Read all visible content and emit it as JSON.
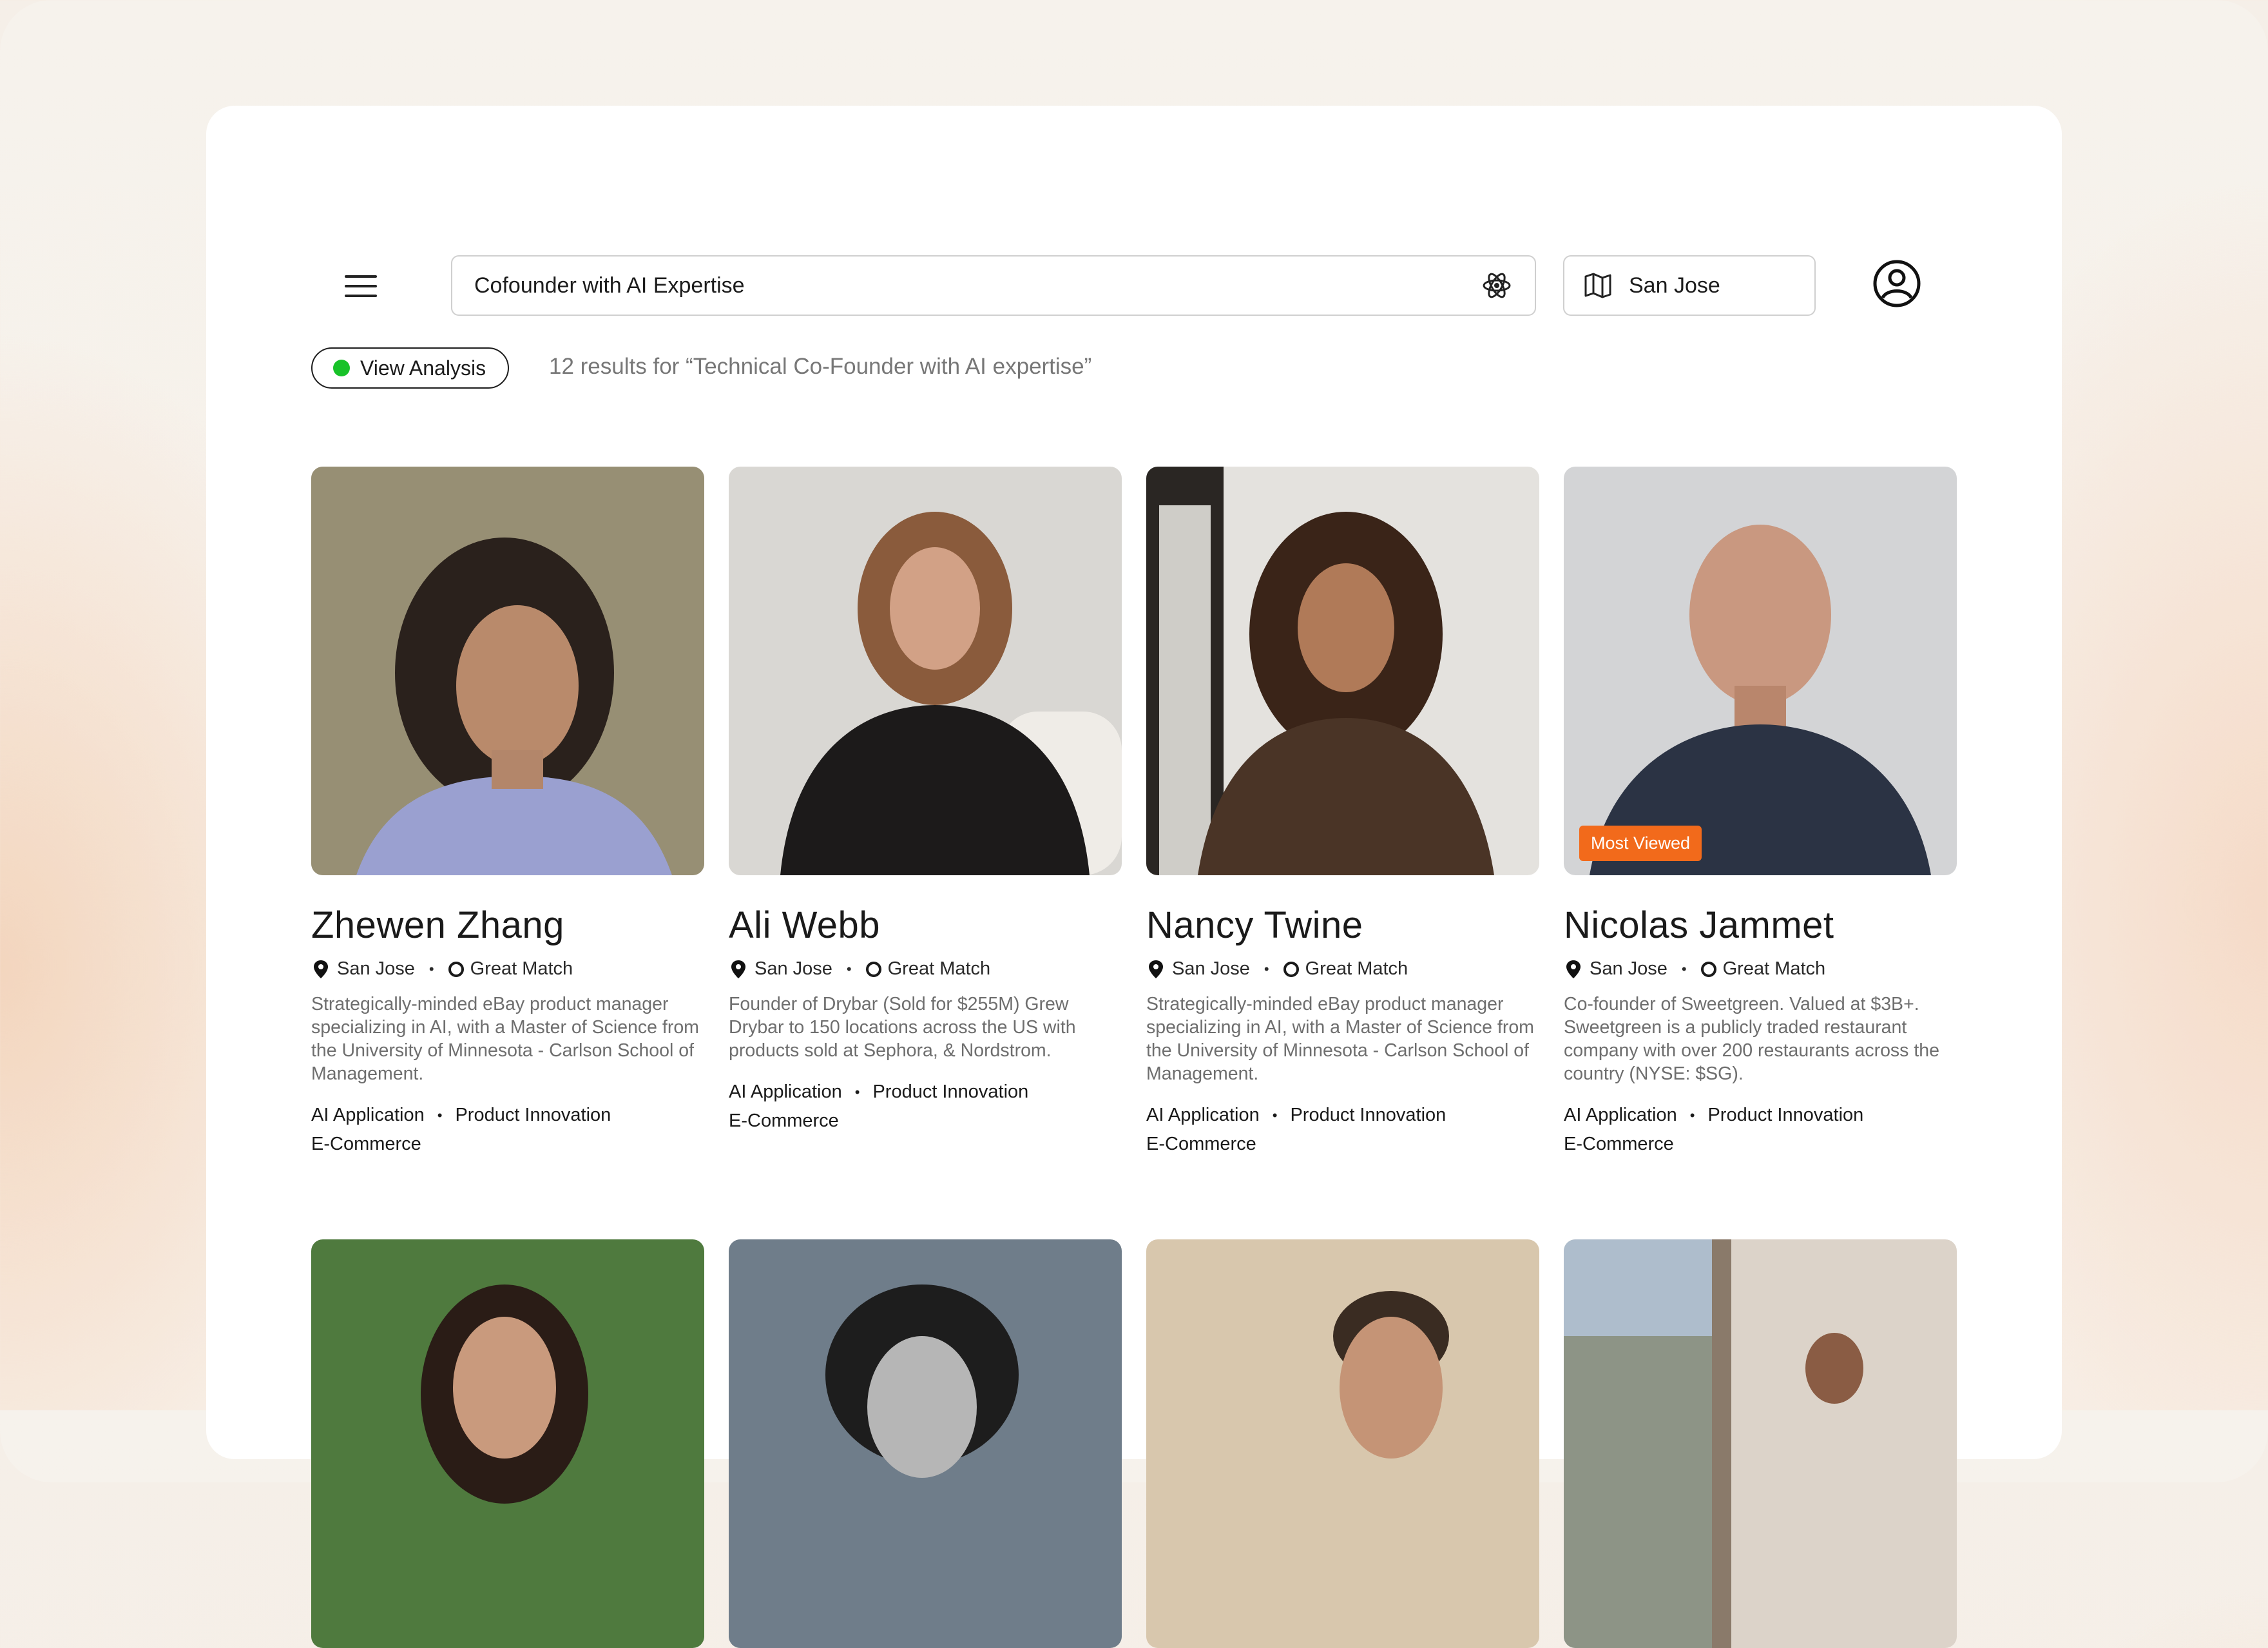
{
  "header": {
    "search_value": "Cofounder with AI Expertise",
    "location_value": "San Jose",
    "view_analysis_label": "View Analysis",
    "results_text": "12 results for “Technical Co-Founder with AI expertise”"
  },
  "colors": {
    "accent_green": "#18c229",
    "badge_orange": "#f26a1b"
  },
  "icons": [
    "menu-icon",
    "atom-icon",
    "map-icon",
    "user-icon",
    "location-pin-icon",
    "match-ring-icon"
  ],
  "cards": [
    {
      "name": "Zhewen Zhang",
      "location": "San Jose",
      "match": "Great Match",
      "description": "Strategically-minded eBay product manager specializing in AI, with a Master of Science from the University of Minnesota - Carlson School of Management.",
      "tag1": "AI Application",
      "tag2": "Product Innovation",
      "tag3": "E-Commerce"
    },
    {
      "name": "Ali Webb",
      "location": "San Jose",
      "match": "Great Match",
      "description": "Founder of Drybar (Sold for $255M) Grew Drybar to 150 locations across the US with products sold at Sephora, & Nordstrom.",
      "tag1": "AI Application",
      "tag2": "Product Innovation",
      "tag3": "E-Commerce"
    },
    {
      "name": "Nancy Twine",
      "location": "San Jose",
      "match": "Great Match",
      "description": "Strategically-minded eBay product manager specializing in AI, with a Master of Science from the University of Minnesota - Carlson School of Management.",
      "tag1": "AI Application",
      "tag2": "Product Innovation",
      "tag3": "E-Commerce"
    },
    {
      "name": "Nicolas Jammet",
      "location": "San Jose",
      "match": "Great Match",
      "badge": "Most Viewed",
      "description": "Co-founder of Sweetgreen. Valued at $3B+. Sweetgreen is a publicly traded restaurant company with over 200 restaurants across the country (NYSE: $SG).",
      "tag1": "AI Application",
      "tag2": "Product Innovation",
      "tag3": "E-Commerce"
    }
  ]
}
